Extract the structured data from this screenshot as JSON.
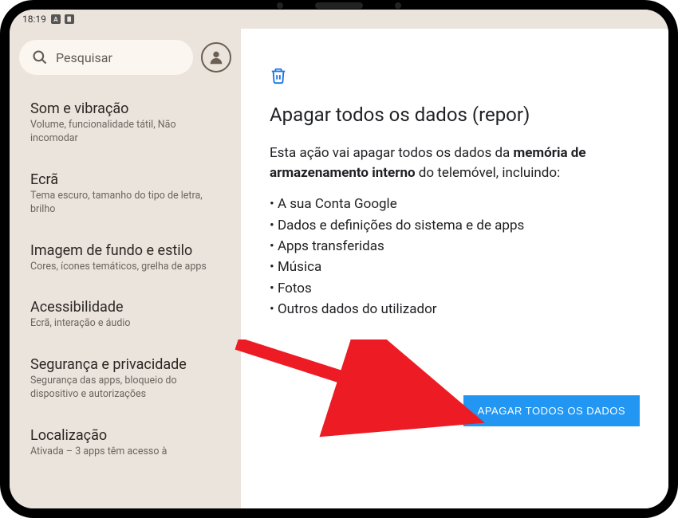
{
  "status": {
    "time": "18:19",
    "icon1": "A",
    "icon2": "□"
  },
  "search": {
    "placeholder": "Pesquisar"
  },
  "sidebar": {
    "items": [
      {
        "title": "Som e vibração",
        "sub": "Volume, funcionalidade tátil, Não incomodar"
      },
      {
        "title": "Ecrã",
        "sub": "Tema escuro, tamanho do tipo de letra, brilho"
      },
      {
        "title": "Imagem de fundo e estilo",
        "sub": "Cores, ícones temáticos, grelha de apps"
      },
      {
        "title": "Acessibilidade",
        "sub": "Ecrã, interação e áudio"
      },
      {
        "title": "Segurança e privacidade",
        "sub": "Segurança das apps, bloqueio do dispositivo e autorizações"
      },
      {
        "title": "Localização",
        "sub": "Ativada – 3 apps têm acesso à"
      }
    ]
  },
  "main": {
    "title": "Apagar todos os dados (repor)",
    "desc_pre": "Esta ação vai apagar todos os dados da ",
    "desc_bold": "memória de armazenamento interno",
    "desc_post": " do telemóvel, incluindo:",
    "bullets": [
      "A sua Conta Google",
      "Dados e definições do sistema e de apps",
      "Apps transferidas",
      "Música",
      "Fotos",
      "Outros dados do utilizador"
    ],
    "button": "APAGAR TODOS OS DADOS"
  }
}
